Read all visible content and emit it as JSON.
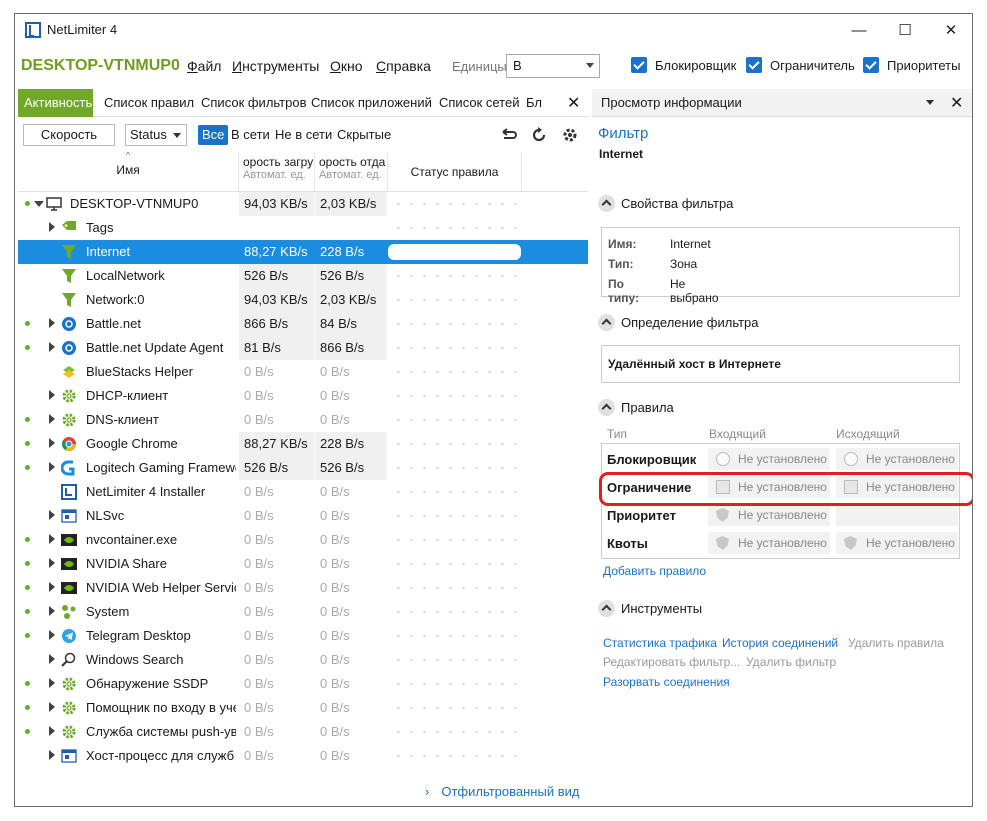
{
  "window": {
    "title": "NetLimiter 4",
    "minimize": "—",
    "maximize": "☐",
    "close": "✕"
  },
  "menubar": {
    "host": "DESKTOP-VTNMUP0",
    "menus": [
      {
        "underline": "Ф",
        "rest": "айл"
      },
      {
        "underline": "И",
        "rest": "нструменты"
      },
      {
        "underline": "О",
        "rest": "кно"
      },
      {
        "underline": "С",
        "rest": "правка"
      }
    ],
    "units_label": "Единицы",
    "units_value": "B",
    "toggles": [
      {
        "label": "Блокировщик",
        "checked": true
      },
      {
        "label": "Ограничитель",
        "checked": true
      },
      {
        "label": "Приоритеты",
        "checked": true
      }
    ]
  },
  "left": {
    "tabs": [
      "Активность",
      "Список правил",
      "Список фильтров",
      "Список приложений",
      "Список сетей",
      "Бл"
    ],
    "active_tab": 0,
    "close": "✕",
    "toolbar": {
      "speed_button": "Скорость",
      "status_select": "Status",
      "filters": [
        "Все",
        "В сети",
        "Не в сети",
        "Скрытые"
      ],
      "active_filter": 0
    },
    "columns": {
      "name": "Имя",
      "in": "орость загру",
      "in_sub": "Автомат. ед.",
      "out": "орость отда",
      "out_sub": "Автомат. ед.",
      "status": "Статус правила"
    },
    "rows": [
      {
        "name": "DESKTOP-VTNMUP0",
        "in": "94,03 KB/s",
        "out": "2,03 KB/s",
        "level": 0,
        "exp": "open",
        "dot": true,
        "icon": "monitor-icon"
      },
      {
        "name": "Tags",
        "in": "",
        "out": "",
        "level": 1,
        "exp": "closed",
        "dot": false,
        "icon": "tag-icon"
      },
      {
        "name": "Internet",
        "in": "88,27 KB/s",
        "out": "228 B/s",
        "level": 1,
        "exp": "none",
        "dot": false,
        "icon": "funnel-icon",
        "selected": true
      },
      {
        "name": "LocalNetwork",
        "in": "526 B/s",
        "out": "526 B/s",
        "level": 1,
        "exp": "none",
        "dot": false,
        "icon": "funnel-icon"
      },
      {
        "name": "Network:0",
        "in": "94,03 KB/s",
        "out": "2,03 KB/s",
        "level": 1,
        "exp": "none",
        "dot": false,
        "icon": "funnel-icon"
      },
      {
        "name": "Battle.net",
        "in": "866 B/s",
        "out": "84 B/s",
        "level": 1,
        "exp": "closed",
        "dot": true,
        "icon": "battlenet-icon"
      },
      {
        "name": "Battle.net Update Agent",
        "in": "81 B/s",
        "out": "866 B/s",
        "level": 1,
        "exp": "closed",
        "dot": true,
        "icon": "battlenet-icon"
      },
      {
        "name": "BlueStacks Helper",
        "in": "0 B/s",
        "out": "0 B/s",
        "level": 1,
        "exp": "none",
        "dot": false,
        "icon": "bluestacks-icon"
      },
      {
        "name": "DHCP-клиент",
        "in": "0 B/s",
        "out": "0 B/s",
        "level": 1,
        "exp": "closed",
        "dot": false,
        "icon": "gear-icon"
      },
      {
        "name": "DNS-клиент",
        "in": "0 B/s",
        "out": "0 B/s",
        "level": 1,
        "exp": "closed",
        "dot": true,
        "icon": "gear-icon"
      },
      {
        "name": "Google Chrome",
        "in": "88,27 KB/s",
        "out": "228 B/s",
        "level": 1,
        "exp": "closed",
        "dot": true,
        "icon": "chrome-icon"
      },
      {
        "name": "Logitech Gaming Framewor",
        "in": "526 B/s",
        "out": "526 B/s",
        "level": 1,
        "exp": "closed",
        "dot": true,
        "icon": "logitech-icon"
      },
      {
        "name": "NetLimiter 4 Installer",
        "in": "0 B/s",
        "out": "0 B/s",
        "level": 1,
        "exp": "none",
        "dot": false,
        "icon": "netlimiter-icon"
      },
      {
        "name": "NLSvc",
        "in": "0 B/s",
        "out": "0 B/s",
        "level": 1,
        "exp": "closed",
        "dot": false,
        "icon": "window-icon"
      },
      {
        "name": "nvcontainer.exe",
        "in": "0 B/s",
        "out": "0 B/s",
        "level": 1,
        "exp": "closed",
        "dot": true,
        "icon": "nvidia-icon"
      },
      {
        "name": "NVIDIA Share",
        "in": "0 B/s",
        "out": "0 B/s",
        "level": 1,
        "exp": "closed",
        "dot": true,
        "icon": "nvidia-icon"
      },
      {
        "name": "NVIDIA Web Helper Service",
        "in": "0 B/s",
        "out": "0 B/s",
        "level": 1,
        "exp": "closed",
        "dot": true,
        "icon": "nvidia-icon"
      },
      {
        "name": "System",
        "in": "0 B/s",
        "out": "0 B/s",
        "level": 1,
        "exp": "closed",
        "dot": true,
        "icon": "system-icon"
      },
      {
        "name": "Telegram Desktop",
        "in": "0 B/s",
        "out": "0 B/s",
        "level": 1,
        "exp": "closed",
        "dot": true,
        "icon": "telegram-icon"
      },
      {
        "name": "Windows Search",
        "in": "0 B/s",
        "out": "0 B/s",
        "level": 1,
        "exp": "closed",
        "dot": false,
        "icon": "search-icon"
      },
      {
        "name": "Обнаружение SSDP",
        "in": "0 B/s",
        "out": "0 B/s",
        "level": 1,
        "exp": "closed",
        "dot": true,
        "icon": "gear-icon"
      },
      {
        "name": "Помощник по входу в учет",
        "in": "0 B/s",
        "out": "0 B/s",
        "level": 1,
        "exp": "closed",
        "dot": true,
        "icon": "gear-icon"
      },
      {
        "name": "Служба системы push-увед",
        "in": "0 B/s",
        "out": "0 B/s",
        "level": 1,
        "exp": "closed",
        "dot": true,
        "icon": "gear-icon"
      },
      {
        "name": "Хост-процесс для служб W",
        "in": "0 B/s",
        "out": "0 B/s",
        "level": 1,
        "exp": "closed",
        "dot": false,
        "icon": "window-icon"
      }
    ],
    "filtered_view": "Отфильтрованный вид"
  },
  "right": {
    "header": "Просмотр информации",
    "filter_label": "Фильтр",
    "filter_name": "Internet",
    "props_title": "Свойства фильтра",
    "props": [
      {
        "k": "Имя:",
        "v": "Internet"
      },
      {
        "k": "Тип:",
        "v": "Зона"
      },
      {
        "k": "По типу:",
        "v": "Не выбрано"
      }
    ],
    "def_title": "Определение фильтра",
    "def_text": "Удалённый хост в Интернете",
    "rules_title": "Правила",
    "rules_cols": {
      "type": "Тип",
      "in": "Входящий",
      "out": "Исходящий"
    },
    "rules": [
      {
        "name": "Блокировщик",
        "in": "Не установлено",
        "out": "Не установлено",
        "kind": "radio"
      },
      {
        "name": "Ограничение",
        "in": "Не установлено",
        "out": "Не установлено",
        "kind": "check"
      },
      {
        "name": "Приоритет",
        "in": "Не установлено",
        "out": "",
        "kind": "shield"
      },
      {
        "name": "Квоты",
        "in": "Не установлено",
        "out": "Не установлено",
        "kind": "shield"
      }
    ],
    "add_rule": "Добавить правило",
    "tools_title": "Инструменты",
    "tools": {
      "traffic": "Статистика трафика",
      "history": "История соединений",
      "delete_rules": "Удалить правила",
      "edit_filter": "Редактировать фильтр...",
      "delete_filter": "Удалить фильтр",
      "disconnect": "Разорвать соединения"
    }
  },
  "colors": {
    "accent_green": "#6fa82a",
    "accent_blue": "#1a73c8",
    "selection": "#1a8de0",
    "highlight": "#e02020"
  }
}
